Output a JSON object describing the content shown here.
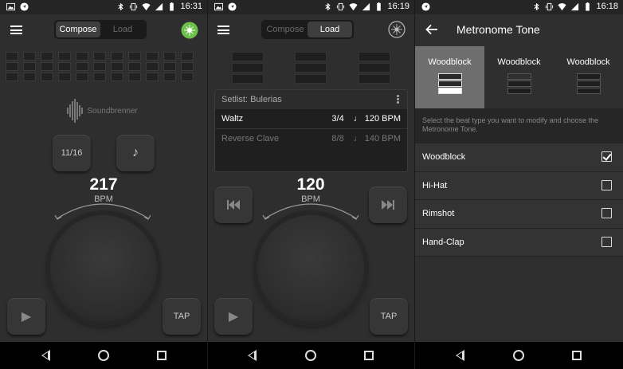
{
  "screens": [
    {
      "status_time": "16:31",
      "segment": [
        "Compose",
        "Load"
      ],
      "logo_text": "Soundbrenner",
      "time_signature": "11/16",
      "subdivision_glyph": "♪",
      "bpm_value": "217",
      "bpm_label": "BPM",
      "tap_label": "TAP",
      "play_glyph": "▶"
    },
    {
      "status_time": "16:19",
      "segment": [
        "Compose",
        "Load"
      ],
      "setlist_title": "Setlist: Bulerias",
      "songs": [
        {
          "name": "Waltz",
          "meter": "3/4",
          "tempo": "♩ 120 BPM"
        },
        {
          "name": "Reverse Clave",
          "meter": "8/8",
          "tempo": "♩ 140 BPM"
        }
      ],
      "bpm_value": "120",
      "bpm_label": "BPM",
      "tap_label": "TAP",
      "play_glyph": "▶"
    },
    {
      "status_time": "16:18",
      "title": "Metronome Tone",
      "tabs": [
        "Woodblock",
        "Woodblock",
        "Woodblock"
      ],
      "hint": "Select the beat type you want to modify and choose the Metronome Tone.",
      "options": [
        {
          "label": "Woodblock",
          "checked": true
        },
        {
          "label": "Hi-Hat",
          "checked": false
        },
        {
          "label": "Rimshot",
          "checked": false
        },
        {
          "label": "Hand-Clap",
          "checked": false
        }
      ]
    }
  ],
  "icons": {
    "status_left": [
      "image-icon",
      "navigation-icon"
    ],
    "status_right": [
      "bluetooth-icon",
      "vibrate-icon",
      "wifi-icon",
      "signal-icon",
      "battery-icon"
    ],
    "nav": [
      "back-icon",
      "home-icon",
      "recents-icon"
    ]
  },
  "colors": {
    "accent_green": "#6cbf4a",
    "background": "#2e2e2e"
  }
}
